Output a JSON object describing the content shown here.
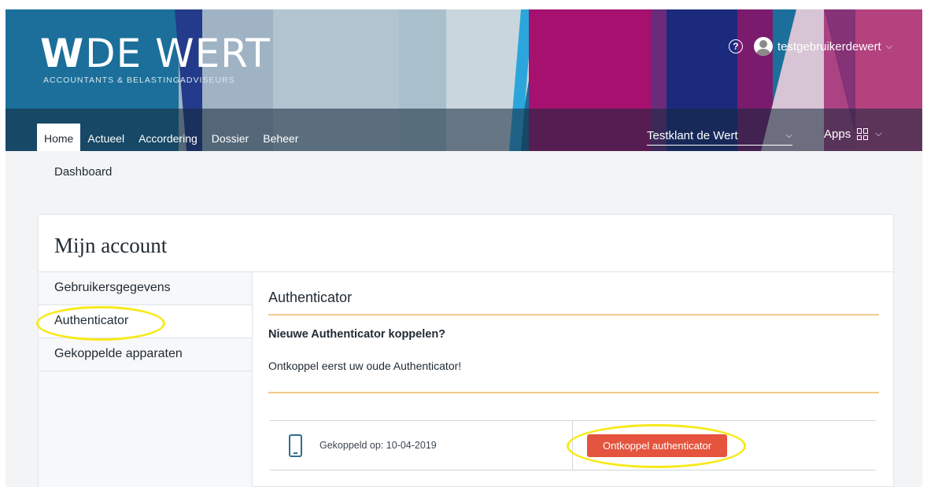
{
  "header": {
    "logo_mark": "W",
    "logo_name": "DE WERT",
    "logo_subtitle": "ACCOUNTANTS & BELASTINGADVISEURS",
    "help_label": "?",
    "username": "testgebruikerdewert",
    "nav": [
      {
        "label": "Home",
        "active": true
      },
      {
        "label": "Actueel"
      },
      {
        "label": "Accordering"
      },
      {
        "label": "Dossier"
      },
      {
        "label": "Beheer"
      }
    ],
    "client_select_value": "Testklant de Wert",
    "apps_label": "Apps"
  },
  "breadcrumb": "Dashboard",
  "account": {
    "title": "Mijn account",
    "sidebar": [
      {
        "label": "Gebruikersgegevens"
      },
      {
        "label": "Authenticator",
        "active": true
      },
      {
        "label": "Gekoppelde apparaten"
      }
    ],
    "section_title": "Authenticator",
    "new_heading": "Nieuwe Authenticator koppelen?",
    "notice": "Ontkoppel eerst uw oude Authenticator!",
    "device": {
      "linked_text": "Gekoppeld op: 10-04-2019",
      "unlink_button": "Ontkoppel authenticator"
    }
  },
  "colors": {
    "button": "#e5543e",
    "highlight": "#f7e91b",
    "separator": "#f2c98a",
    "accent_blue": "#1b6f9a"
  }
}
